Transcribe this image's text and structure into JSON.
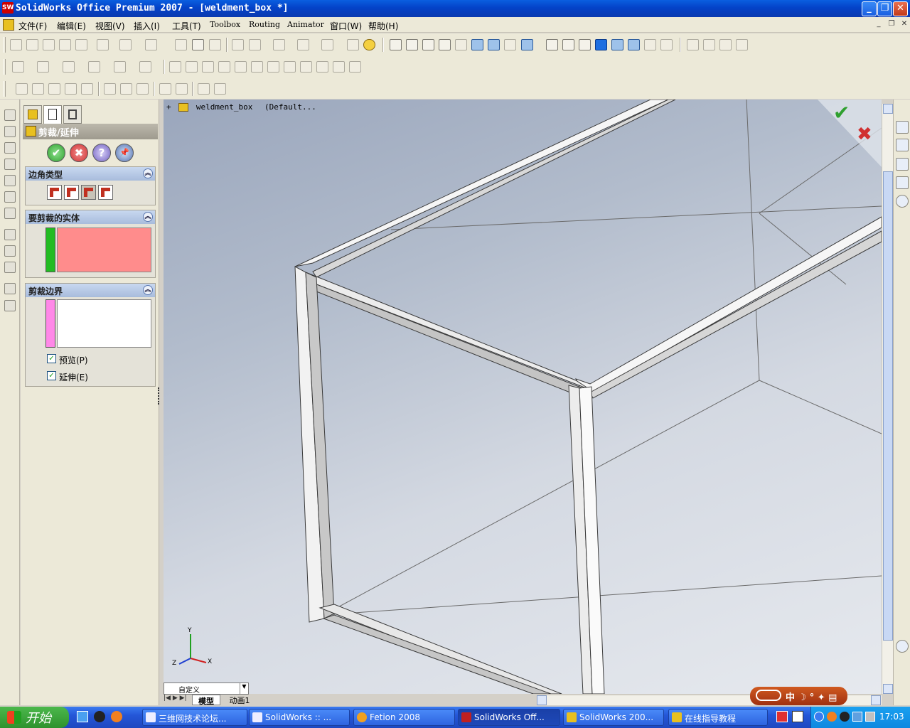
{
  "window": {
    "app_icon": "solidworks-logo-icon",
    "title": "SolidWorks Office Premium 2007 - [weldment_box *]",
    "buttons": {
      "minimize": "_",
      "maximize": "❐",
      "close": "✕"
    }
  },
  "menubar": {
    "items": [
      "文件(F)",
      "编辑(E)",
      "视图(V)",
      "插入(I)",
      "工具(T)",
      "Toolbox",
      "Routing",
      "Animator",
      "窗口(W)",
      "帮助(H)"
    ],
    "doc_buttons": [
      "_",
      "❐",
      "✕"
    ]
  },
  "feature_panel": {
    "title": "剪裁/延伸",
    "actions": {
      "ok": "✔",
      "cancel": "✖",
      "help": "?",
      "pin": "📌"
    },
    "groups": {
      "corner_type": {
        "label": "边角类型",
        "collapse": "︽"
      },
      "bodies_to_trim": {
        "label": "要剪裁的实体",
        "collapse": "︽"
      },
      "trim_boundary": {
        "label": "剪裁边界",
        "collapse": "︽"
      }
    },
    "options": {
      "preview": {
        "label": "预览(P)",
        "checked": true
      },
      "extend": {
        "label": "延伸(E)",
        "checked": true
      }
    }
  },
  "graphics": {
    "tree_expand": "+",
    "tree_item": "weldment_box",
    "tree_config": "(Default...",
    "confirm_ok": "✔",
    "confirm_cancel": "✖",
    "triad": {
      "x": "X",
      "y": "Y",
      "z": "Z"
    }
  },
  "bottom": {
    "view_combo": "自定义",
    "tabs": [
      "模型",
      "动画1"
    ]
  },
  "taskbar": {
    "start": "开始",
    "tasks": [
      "三维网技术论坛...",
      "SolidWorks :: ...",
      "Fetion 2008",
      "SolidWorks Off...",
      "SolidWorks 200...",
      "在线指导教程"
    ],
    "active_task": 3,
    "clock": "17:03"
  },
  "colors": {
    "titlebar": "#0a4fd8",
    "bodies_to_trim_fill": "#ff8c8c",
    "bodies_to_trim_marker": "#22bb22",
    "boundary_marker": "#ff88e8",
    "accept_green": "#2fa02f",
    "reject_red": "#d03030"
  }
}
